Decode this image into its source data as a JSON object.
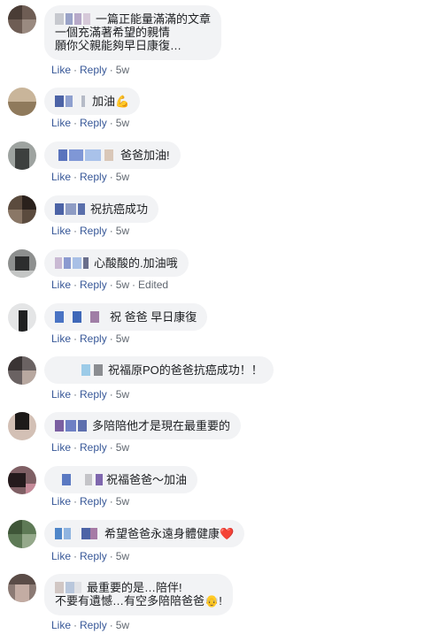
{
  "actions": {
    "like_label": "Like",
    "reply_label": "Reply",
    "separator": "·",
    "time_label": "5w",
    "edited_label": "Edited"
  },
  "comments": [
    {
      "lines": [
        "一篇正能量滿滿的文章",
        "一個充滿著希望的親情",
        "願你父親能夠早日康復…"
      ]
    },
    {
      "lines": [
        "加油"
      ],
      "emoji": "💪"
    },
    {
      "lines": [
        "爸爸加油!"
      ]
    },
    {
      "lines": [
        "祝抗癌成功"
      ]
    },
    {
      "lines": [
        "心酸酸的.加油哦"
      ],
      "edited": true
    },
    {
      "lines": [
        "祝 爸爸 早日康復"
      ]
    },
    {
      "lines": [
        "祝福原PO的爸爸抗癌成功！！"
      ]
    },
    {
      "lines": [
        "多陪陪他才是現在最重要的"
      ]
    },
    {
      "lines": [
        "祝福爸爸～加油"
      ]
    },
    {
      "lines": [
        "希望爸爸永遠身體健康"
      ],
      "emoji": "❤️"
    },
    {
      "lines": [
        "最重要的是…陪伴!",
        "不要有遺憾…有空多陪陪爸爸"
      ],
      "emoji": "👴",
      "trailing": "!"
    }
  ],
  "colors": {
    "bubble": "#f2f3f5",
    "link": "#385898",
    "meta": "#606770"
  }
}
